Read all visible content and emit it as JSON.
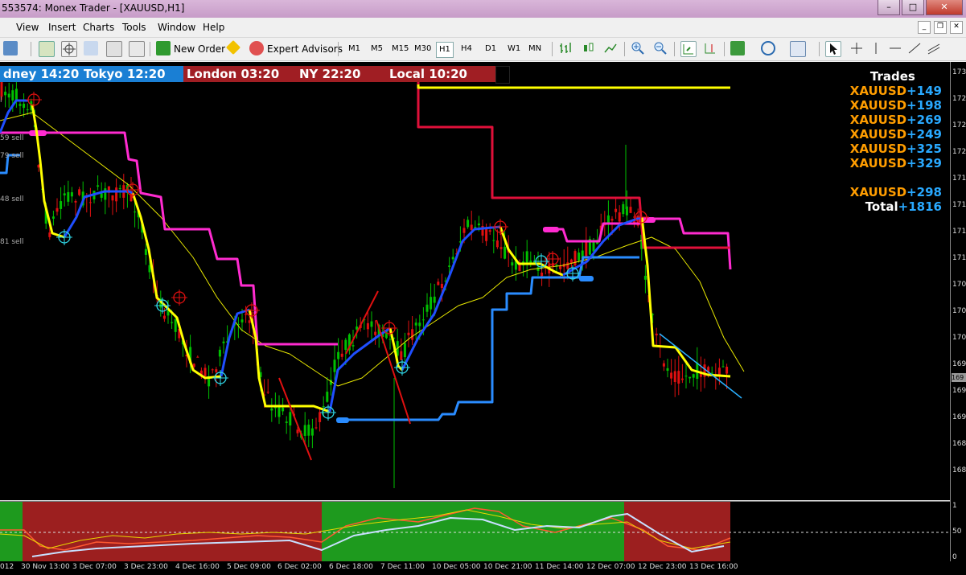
{
  "window": {
    "title": "553574: Monex Trader - [XAUUSD,H1]",
    "buttons": {
      "minimize": "–",
      "maximize": "□",
      "close": "✕"
    }
  },
  "menu": [
    "View",
    "Insert",
    "Charts",
    "Tools",
    "Window",
    "Help"
  ],
  "toolbar": {
    "new_order": "New Order",
    "expert_advisors": "Expert Advisors",
    "timeframes": [
      "M1",
      "M5",
      "M15",
      "M30",
      "H1",
      "H4",
      "D1",
      "W1",
      "MN"
    ],
    "active_timeframe": "H1"
  },
  "sessions": {
    "sydney": "dney 14:20",
    "tokyo": "Tokyo 12:20",
    "london": "London 03:20",
    "ny": "NY    22:20",
    "local": "Local    10:20"
  },
  "trades": {
    "heading": "Trades",
    "rows": [
      {
        "symbol": "XAUUSD",
        "value": "+149"
      },
      {
        "symbol": "XAUUSD",
        "value": "+198"
      },
      {
        "symbol": "XAUUSD",
        "value": "+269"
      },
      {
        "symbol": "XAUUSD",
        "value": "+249"
      },
      {
        "symbol": "XAUUSD",
        "value": "+325"
      },
      {
        "symbol": "XAUUSD",
        "value": "+329"
      }
    ],
    "open": {
      "symbol": "XAUUSD",
      "value": "+298"
    },
    "total_label": "Total",
    "total_value": "+1816"
  },
  "sell_labels": [
    "l",
    "59 sell",
    "79 sell",
    "48 sell",
    "81 sell"
  ],
  "price_axis": [
    "173",
    "172",
    "172",
    "172",
    "171",
    "171",
    "171",
    "171",
    "170",
    "170",
    "170",
    "169",
    "169",
    "169",
    "168",
    "168"
  ],
  "price_current": "169",
  "sub_axis": [
    "1",
    "50",
    "0"
  ],
  "time_axis": [
    "012",
    "30 Nov 13:00",
    "3 Dec 07:00",
    "3 Dec 23:00",
    "4 Dec 16:00",
    "5 Dec 09:00",
    "6 Dec 02:00",
    "6 Dec 18:00",
    "7 Dec 11:00",
    "10 Dec 05:00",
    "10 Dec 21:00",
    "11 Dec 14:00",
    "12 Dec 07:00",
    "12 Dec 23:00",
    "13 Dec 16:00"
  ],
  "colors": {
    "chart_bg": "#000000",
    "candle": "#00c000",
    "bear_candle": "#e01010",
    "session_blue": "#1a7fd4",
    "session_red": "#a01e23",
    "trend_yellow": "#ffff00",
    "trend_blue": "#1f4fff",
    "magenta": "#ff2bd0",
    "crimson": "#e0103a",
    "lightblue": "#2a8cff",
    "sub_green": "#1e9a1e",
    "sub_red": "#9c1f1f"
  }
}
